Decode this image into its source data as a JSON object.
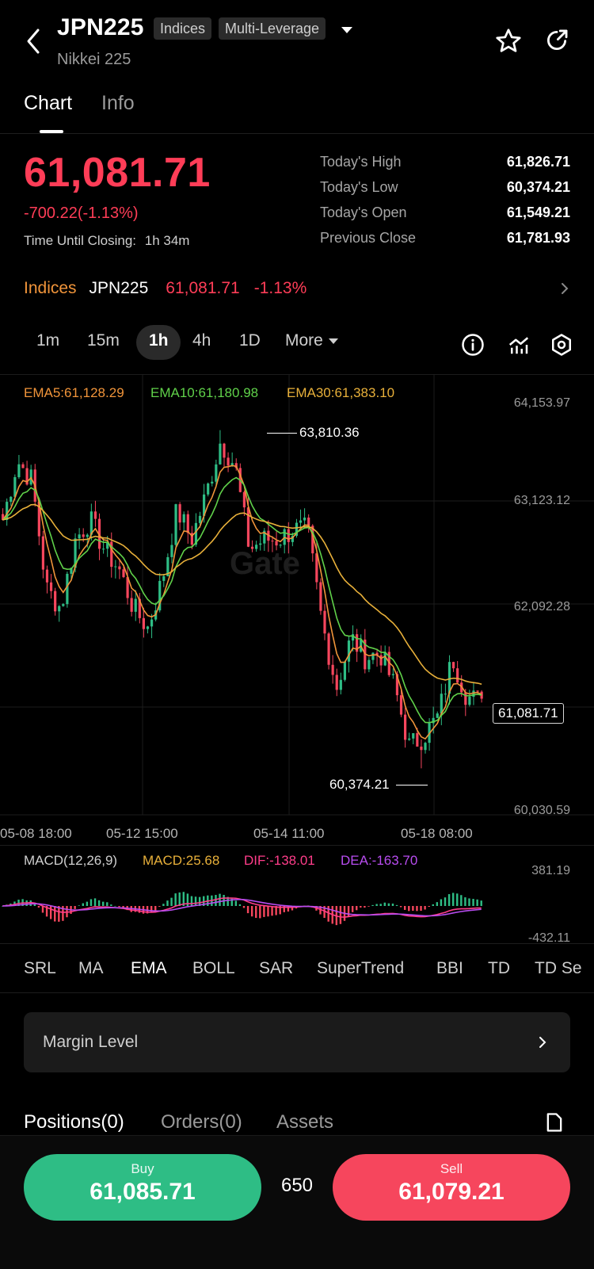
{
  "header": {
    "symbol": "JPN225",
    "tag_indices": "Indices",
    "tag_leverage": "Multi-Leverage",
    "subtitle": "Nikkei 225"
  },
  "tabs": [
    {
      "label": "Chart"
    },
    {
      "label": "Info"
    }
  ],
  "price": {
    "last": "61,081.71",
    "change": "-700.22(-1.13%)",
    "closing_label": "Time Until Closing:",
    "closing_time": "1h 34m"
  },
  "stats": [
    {
      "label": "Today's High",
      "value": "61,826.71"
    },
    {
      "label": "Today's Low",
      "value": "60,374.21"
    },
    {
      "label": "Today's Open",
      "value": "61,549.21"
    },
    {
      "label": "Previous Close",
      "value": "61,781.93"
    }
  ],
  "ticker": {
    "category": "Indices",
    "symbol": "JPN225",
    "price": "61,081.71",
    "change": "-1.13%"
  },
  "timeframes": {
    "items": [
      "1m",
      "15m",
      "1h",
      "4h",
      "1D"
    ],
    "active": "1h",
    "more": "More"
  },
  "ema": {
    "ema5": "EMA5:61,128.29",
    "ema10": "EMA10:61,180.98",
    "ema30": "EMA30:61,383.10"
  },
  "price_axis": [
    "64,153.97",
    "63,123.12",
    "62,092.28",
    "60,030.59"
  ],
  "time_axis": [
    "05-08 18:00",
    "05-12 15:00",
    "05-14 11:00",
    "05-18 08:00"
  ],
  "chart_annotations": {
    "high": "63,810.36",
    "low": "60,374.21",
    "current": "61,081.71"
  },
  "macd": {
    "title": "MACD(12,26,9)",
    "macd": "MACD:25.68",
    "dif": "DIF:-138.01",
    "dea": "DEA:-163.70",
    "axis_top": "381.19",
    "axis_bottom": "-432.11"
  },
  "indicator_tabs": [
    "SRL",
    "MA",
    "EMA",
    "BOLL",
    "SAR",
    "SuperTrend",
    "BBI",
    "TD",
    "TD Se"
  ],
  "margin": {
    "label": "Margin Level"
  },
  "position_tabs": [
    "Positions(0)",
    "Orders(0)",
    "Assets"
  ],
  "trade": {
    "buy_label": "Buy",
    "buy_price": "61,085.71",
    "spread": "650",
    "sell_label": "Sell",
    "sell_price": "61,079.21"
  },
  "colors": {
    "up": "#2ebd85",
    "down": "#f6465d",
    "price_red": "#ff3d57",
    "ema5": "#f0943a",
    "ema10": "#60d14a",
    "ema30": "#e8b03a",
    "dif": "#ff3d8a",
    "dea": "#b84cf0"
  },
  "chart_data": {
    "type": "candlestick",
    "ylim": [
      60030.59,
      64153.97
    ],
    "high": 63810.36,
    "low": 60374.21,
    "last": 61081.71,
    "path": [
      62900,
      63500,
      63300,
      62200,
      62000,
      62700,
      62900,
      62600,
      62400,
      62000,
      61800,
      62300,
      63000,
      62700,
      63150,
      63700,
      63450,
      62600,
      62700,
      62700,
      62800,
      62800,
      61850,
      61200,
      61700,
      61500,
      61550,
      61200,
      60600,
      60700,
      60900,
      61500,
      61100,
      61050
    ]
  }
}
